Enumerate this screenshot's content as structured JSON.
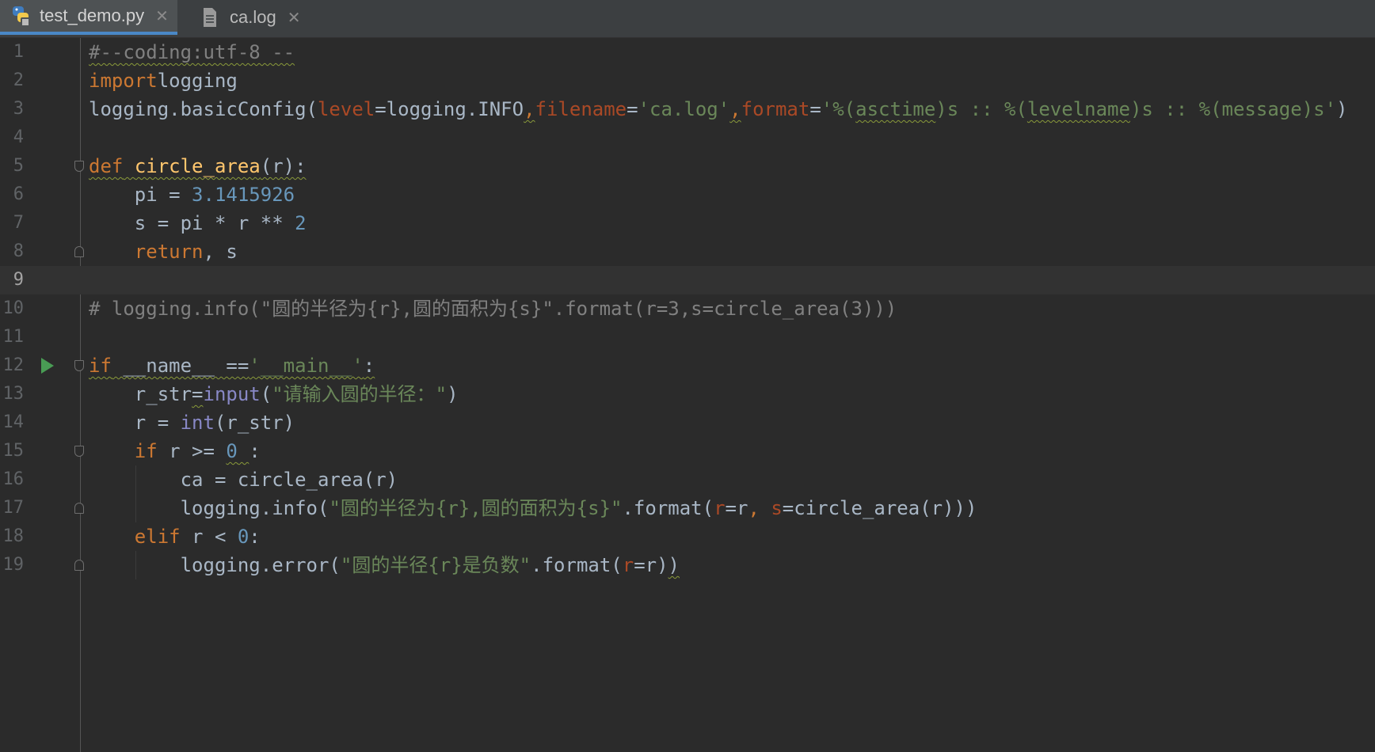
{
  "tabs": [
    {
      "label": "test_demo.py",
      "close": "✕",
      "icon": "python-file-icon",
      "active": true
    },
    {
      "label": "ca.log",
      "close": "✕",
      "icon": "text-file-icon",
      "active": false
    }
  ],
  "editor": {
    "current_line": 9,
    "lines": [
      {
        "n": "1"
      },
      {
        "n": "2"
      },
      {
        "n": "3"
      },
      {
        "n": "4"
      },
      {
        "n": "5"
      },
      {
        "n": "6"
      },
      {
        "n": "7"
      },
      {
        "n": "8"
      },
      {
        "n": "9"
      },
      {
        "n": "10"
      },
      {
        "n": "11"
      },
      {
        "n": "12"
      },
      {
        "n": "13"
      },
      {
        "n": "14"
      },
      {
        "n": "15"
      },
      {
        "n": "16"
      },
      {
        "n": "17"
      },
      {
        "n": "18"
      },
      {
        "n": "19"
      }
    ],
    "code": [
      [
        [
          "cm sq",
          "#--coding:utf-8 --"
        ]
      ],
      [
        [
          "kw",
          "import"
        ],
        [
          "",
          "logging"
        ]
      ],
      [
        [
          "",
          "logging.basicConfig("
        ],
        [
          "param",
          "level"
        ],
        [
          "",
          "=logging.INFO"
        ],
        [
          "kw sq",
          ","
        ],
        [
          "param",
          "filename"
        ],
        [
          "",
          "="
        ],
        [
          "str",
          "'ca.log'"
        ],
        [
          "kw sq",
          ","
        ],
        [
          "param",
          "format"
        ],
        [
          "",
          "="
        ],
        [
          "str",
          "'%("
        ],
        [
          "str sq",
          "asctime"
        ],
        [
          "str",
          ")s :: %("
        ],
        [
          "str sq",
          "levelname"
        ],
        [
          "str",
          ")s :: %(message)s'"
        ],
        [
          "",
          ")"
        ]
      ],
      [],
      [
        [
          "kw sq",
          "def"
        ],
        [
          "sq",
          " "
        ],
        [
          "fn sq",
          "circle_area"
        ],
        [
          "sq",
          "(r):"
        ]
      ],
      [
        [
          "",
          "    pi = "
        ],
        [
          "num",
          "3.1415926"
        ]
      ],
      [
        [
          "",
          "    s = pi * r ** "
        ],
        [
          "num",
          "2"
        ]
      ],
      [
        [
          "",
          "    "
        ],
        [
          "kw",
          "return"
        ],
        [
          "",
          ", s"
        ]
      ],
      [],
      [
        [
          "cm",
          "# logging.info(\"圆的半径为{r},圆的面积为{s}\".format(r=3,s=circle_area(3)))"
        ]
      ],
      [],
      [
        [
          "kw sq",
          "if"
        ],
        [
          "sq",
          " __name__ =="
        ],
        [
          "str sq",
          "'__main__'"
        ],
        [
          "sq",
          ":"
        ]
      ],
      [
        [
          "",
          "    r_str"
        ],
        [
          "sq",
          "="
        ],
        [
          "bi",
          "input"
        ],
        [
          "",
          "("
        ],
        [
          "str",
          "\"请输入圆的半径：\""
        ],
        [
          "",
          ")"
        ]
      ],
      [
        [
          "",
          "    r = "
        ],
        [
          "bi",
          "int"
        ],
        [
          "",
          "(r_str)"
        ]
      ],
      [
        [
          "",
          "    "
        ],
        [
          "kw",
          "if"
        ],
        [
          "",
          " r >= "
        ],
        [
          "num sq",
          "0"
        ],
        [
          "sq",
          " "
        ],
        [
          "",
          ":"
        ]
      ],
      [
        [
          "",
          "        ca = circle_area(r)"
        ]
      ],
      [
        [
          "",
          "        logging.info("
        ],
        [
          "str",
          "\"圆的半径为{r},圆的面积为{s}\""
        ],
        [
          "",
          ".format("
        ],
        [
          "param",
          "r"
        ],
        [
          "",
          "=r"
        ],
        [
          "kw",
          ","
        ],
        [
          "",
          " "
        ],
        [
          "param",
          "s"
        ],
        [
          "",
          "=circle_area(r)))"
        ]
      ],
      [
        [
          "",
          "    "
        ],
        [
          "kw",
          "elif"
        ],
        [
          "",
          " r < "
        ],
        [
          "num",
          "0"
        ],
        [
          "",
          ":"
        ]
      ],
      [
        [
          "",
          "        logging.error("
        ],
        [
          "str",
          "\"圆的半径{r}是负数\""
        ],
        [
          "",
          ".format("
        ],
        [
          "param",
          "r"
        ],
        [
          "",
          "=r)"
        ],
        [
          "sq",
          ")"
        ]
      ]
    ]
  }
}
